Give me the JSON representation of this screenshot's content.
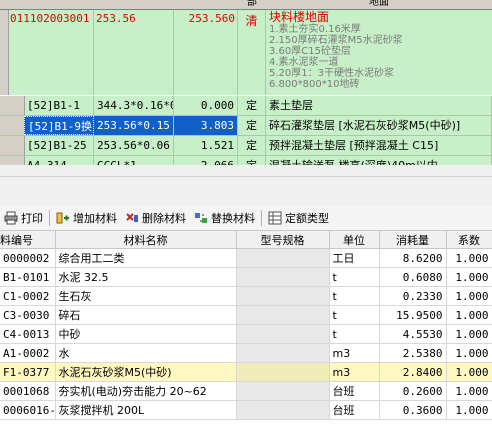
{
  "top_header": [
    "部",
    "地面"
  ],
  "main_row": {
    "code": "011102003001",
    "qty_expr": "253.56",
    "qty": "253.560",
    "type": "清",
    "title": "块料楼地面",
    "desc_lines": [
      "1.素土夯实0.16米厚",
      "2.150厚碎石灌浆M5水泥砂浆",
      "3.60厚C15砼垫层",
      "4.素水泥浆一道",
      "5.20厚1：3干硬性水泥砂浆",
      "6.800*800*10地砖"
    ]
  },
  "sub_rows": [
    {
      "code": "[52]B1-1",
      "expr": "344.3*0.16*0",
      "qty": "0.000",
      "type": "定",
      "name": "素土垫层"
    },
    {
      "code": "[52]B1-9换",
      "expr": "253.56*0.15",
      "qty": "3.803",
      "type": "定",
      "name": "碎石灌浆垫层 [水泥石灰砂浆M5(中砂)]"
    },
    {
      "code": "[52]B1-25",
      "expr": "253.56*0.06",
      "qty": "1.521",
      "type": "定",
      "name": "预拌混凝土垫层 [预拌混凝土 C15]"
    },
    {
      "code": "A4-314",
      "expr": "GCGL*1",
      "qty": "2.066",
      "type": "定",
      "name": "混凝土输送泵 楼高(深度)40m以内"
    }
  ],
  "toolbar": {
    "print": "打印",
    "add": "增加材料",
    "delete": "删除材料",
    "replace": "替换材料",
    "quota_type": "定额类型"
  },
  "columns": [
    "料编号",
    "材料名称",
    "型号规格",
    "单位",
    "消耗量",
    "系数"
  ],
  "materials": [
    {
      "code": "0000002",
      "name": "综合用工二类",
      "spec": "",
      "unit": "工日",
      "consumption": "8.6200",
      "factor": "1.000"
    },
    {
      "code": "B1-0101",
      "name": "水泥 32.5",
      "spec": "",
      "unit": "t",
      "consumption": "0.6080",
      "factor": "1.000"
    },
    {
      "code": "C1-0002",
      "name": "生石灰",
      "spec": "",
      "unit": "t",
      "consumption": "0.2330",
      "factor": "1.000"
    },
    {
      "code": "C3-0030",
      "name": "碎石",
      "spec": "",
      "unit": "t",
      "consumption": "15.9500",
      "factor": "1.000"
    },
    {
      "code": "C4-0013",
      "name": "中砂",
      "spec": "",
      "unit": "t",
      "consumption": "4.5530",
      "factor": "1.000"
    },
    {
      "code": "A1-0002",
      "name": "水",
      "spec": "",
      "unit": "m3",
      "consumption": "2.5380",
      "factor": "1.000"
    },
    {
      "code": "F1-0377",
      "name": "水泥石灰砂浆M5(中砂)",
      "spec": "",
      "unit": "m3",
      "consumption": "2.8400",
      "factor": "1.000"
    },
    {
      "code": "0001068",
      "name": "夯实机(电动)夯击能力 20~62",
      "spec": "",
      "unit": "台班",
      "consumption": "0.2600",
      "factor": "1.000"
    },
    {
      "code": "0006016-1",
      "name": "灰浆搅拌机 200L",
      "spec": "",
      "unit": "台班",
      "consumption": "0.3600",
      "factor": "1.000"
    }
  ],
  "colors": {
    "row_green": "#c8f0c8",
    "selection": "#1060c8",
    "red_text": "#e00000",
    "highlight_row": "#fff8c0"
  }
}
